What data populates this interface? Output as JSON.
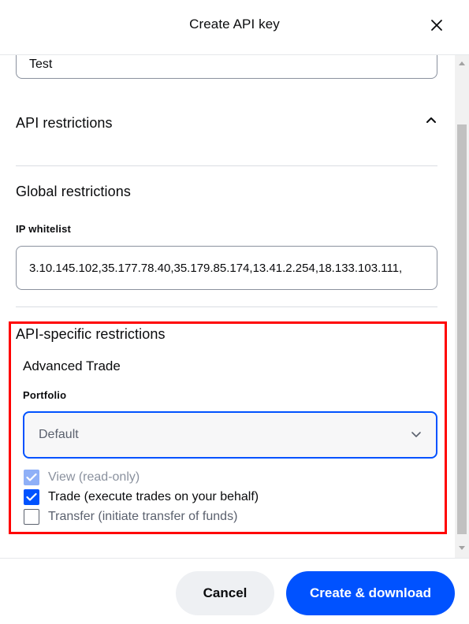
{
  "dialog": {
    "title": "Create API key"
  },
  "name_field": {
    "value": "Test"
  },
  "api_restrictions": {
    "title": "API restrictions"
  },
  "global_restrictions": {
    "title": "Global restrictions",
    "ip_whitelist_label": "IP whitelist",
    "ip_whitelist_value": "3.10.145.102,35.177.78.40,35.179.85.174,13.41.2.254,18.133.103.111,"
  },
  "api_specific": {
    "title": "API-specific restrictions",
    "advanced_trade": {
      "title": "Advanced Trade",
      "portfolio_label": "Portfolio",
      "portfolio_value": "Default"
    },
    "permissions": [
      {
        "label": "View (read-only)",
        "checked": true,
        "disabled": true
      },
      {
        "label": "Trade (execute trades on your behalf)",
        "checked": true,
        "disabled": false
      },
      {
        "label": "Transfer (initiate transfer of funds)",
        "checked": false,
        "disabled": false
      }
    ]
  },
  "footer": {
    "cancel_label": "Cancel",
    "create_label": "Create & download"
  },
  "colors": {
    "primary": "#0052ff",
    "highlight": "#ff0000",
    "cancel_bg": "#eef0f3"
  },
  "icons": {
    "close": "close-icon",
    "collapse": "chevron-up-icon",
    "dropdown": "chevron-down-icon",
    "check": "checkmark-icon"
  }
}
